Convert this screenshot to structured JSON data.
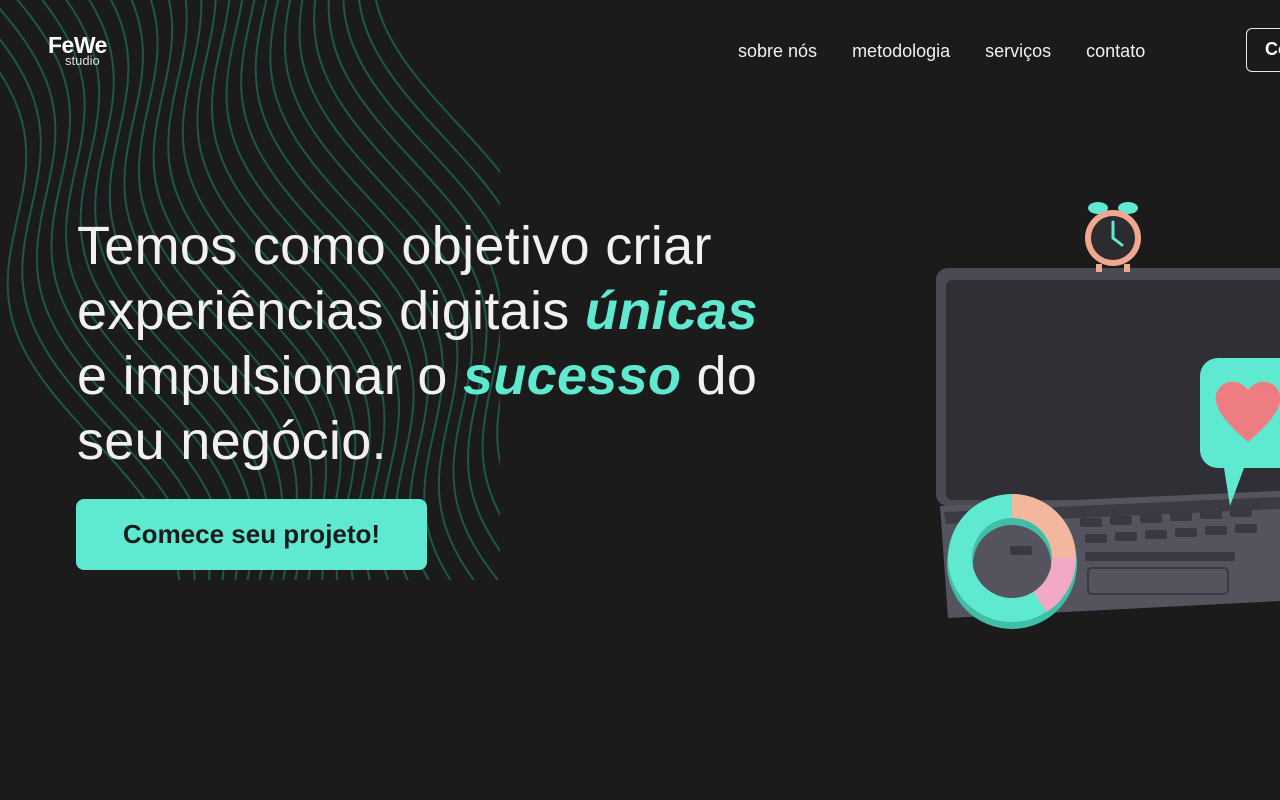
{
  "brand": {
    "name": "FeWe",
    "sub": "studio"
  },
  "nav": {
    "items": [
      {
        "label": "sobre nós"
      },
      {
        "label": "metodologia"
      },
      {
        "label": "serviços"
      },
      {
        "label": "contato"
      }
    ],
    "cta_label": "Contato"
  },
  "hero": {
    "line1": "Temos como objetivo criar",
    "line2_pre": "experiências digitais ",
    "line2_em": "únicas",
    "line3_pre": "e impulsionar o ",
    "line3_em": "sucesso",
    "line3_post": " do",
    "line4": "seu negócio.",
    "button_label": "Comece seu projeto!"
  },
  "colors": {
    "accent": "#5ee9d0",
    "background": "#1b1b1b",
    "text": "#f2f2f2"
  },
  "illustration": {
    "icons": [
      "laptop-icon",
      "alarm-clock-icon",
      "heart-chat-bubble-icon",
      "donut-chart-icon"
    ]
  }
}
